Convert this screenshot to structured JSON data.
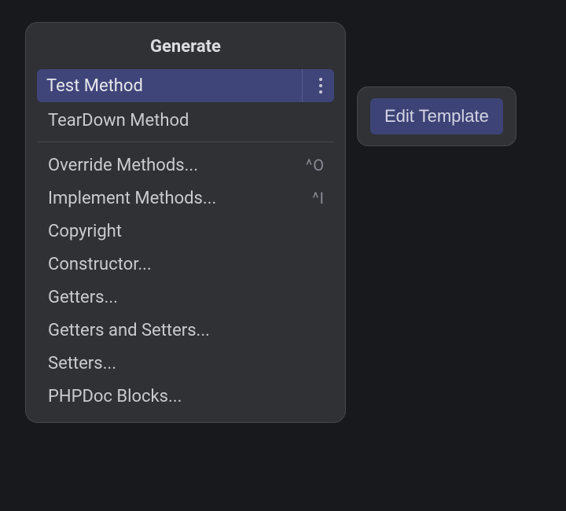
{
  "menu": {
    "title": "Generate",
    "items": [
      {
        "label": "Test Method",
        "selected": true,
        "hasMore": true
      },
      {
        "label": "TearDown Method"
      }
    ],
    "separator": true,
    "items2": [
      {
        "label": "Override Methods...",
        "shortcut": "^O"
      },
      {
        "label": "Implement Methods...",
        "shortcut": "^I"
      },
      {
        "label": "Copyright"
      },
      {
        "label": "Constructor..."
      },
      {
        "label": "Getters..."
      },
      {
        "label": "Getters and Setters..."
      },
      {
        "label": "Setters..."
      },
      {
        "label": "PHPDoc Blocks..."
      }
    ]
  },
  "tooltip": {
    "button": "Edit Template"
  }
}
